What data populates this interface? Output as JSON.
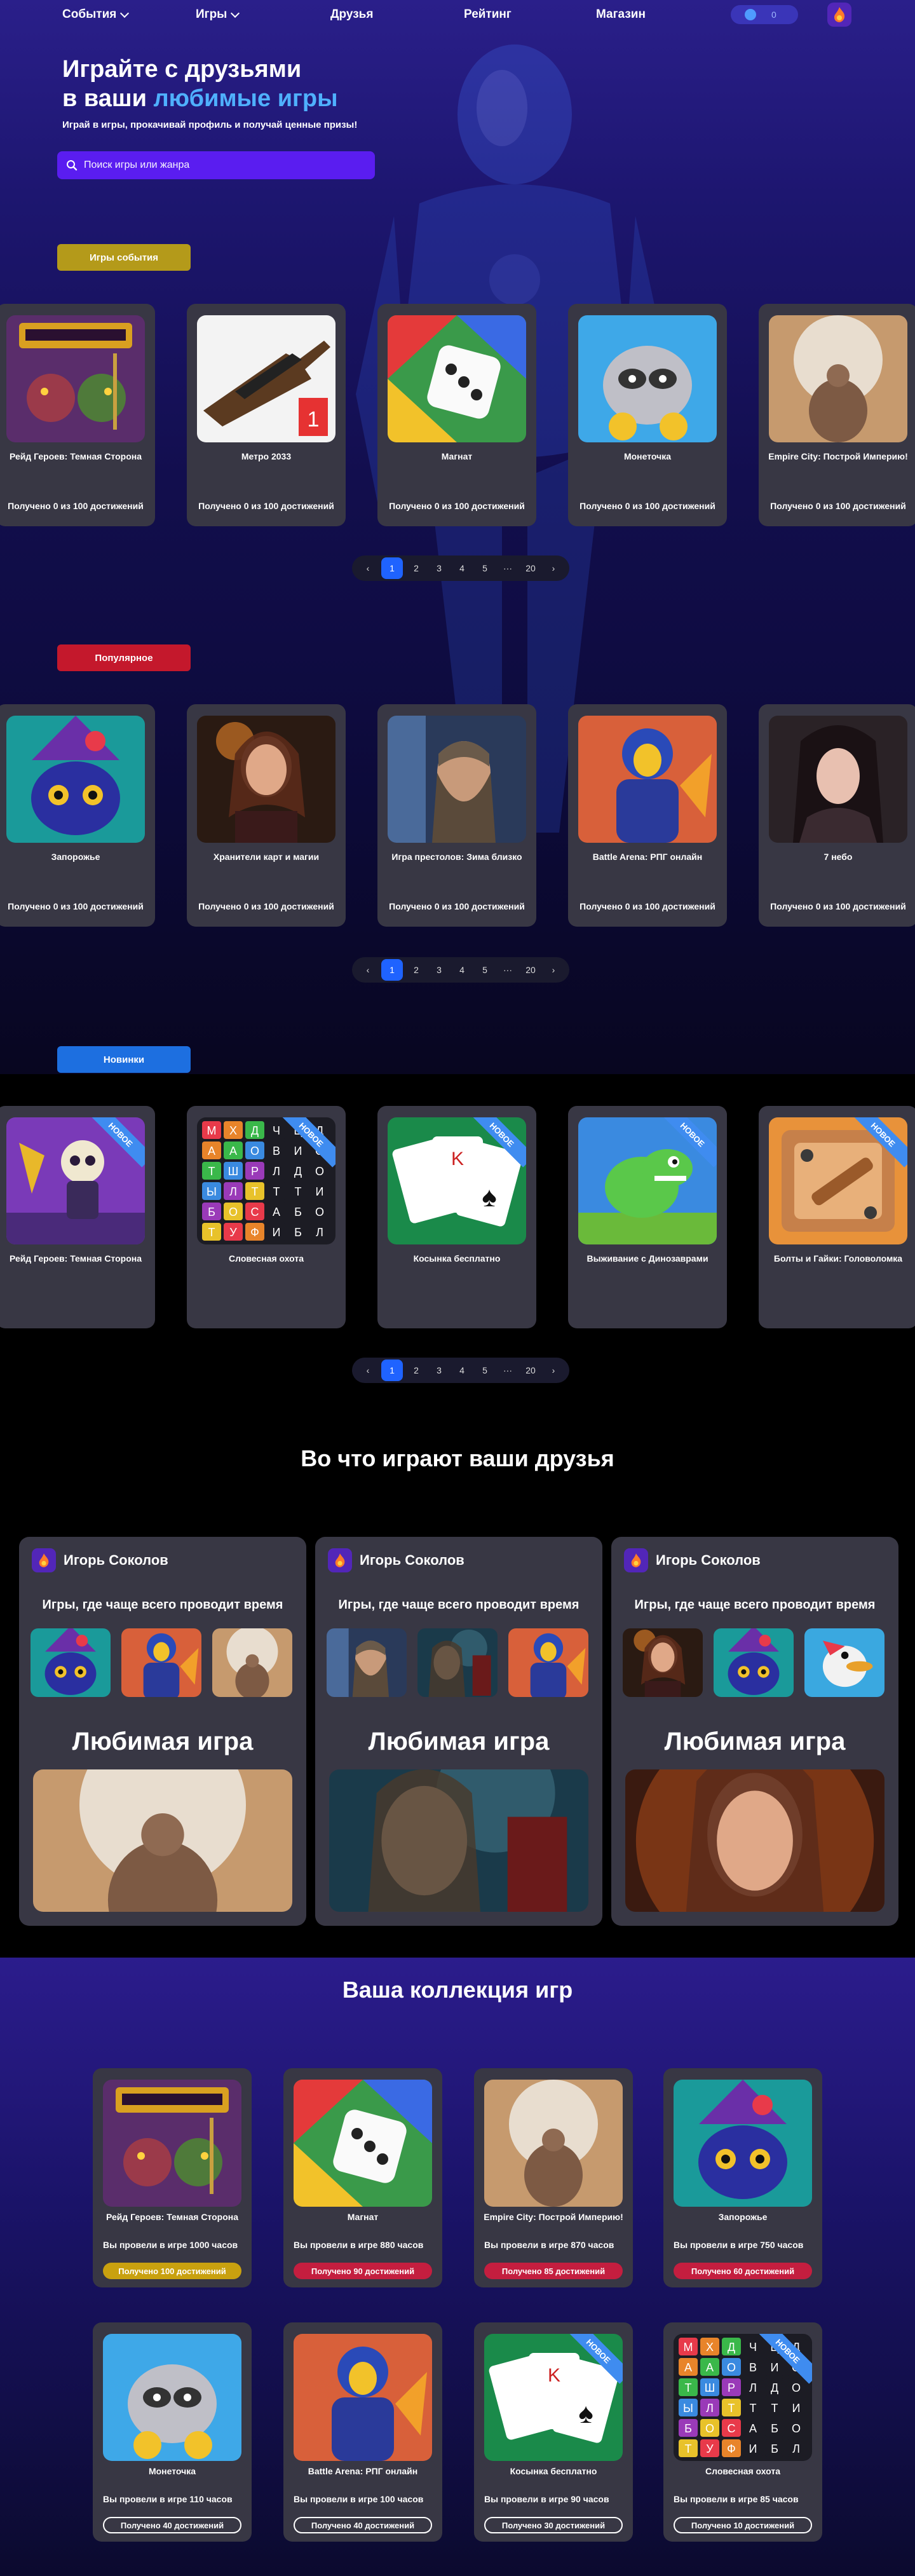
{
  "nav": {
    "events": "События",
    "games": "Игры",
    "friends": "Друзья",
    "rating": "Рейтинг",
    "shop": "Магазин",
    "toggle_value": "0"
  },
  "hero": {
    "title_line1": "Играйте с друзьями",
    "title_line2_prefix": "в ваши ",
    "title_line2_highlight": "любимые игры",
    "subtitle": "Играй в игры, прокачивай профиль и получай ценные призы!",
    "search_placeholder": "Поиск игры или жанра"
  },
  "sections": {
    "events": {
      "label": "Игры события",
      "color": "#b49a1a",
      "cards": [
        {
          "title": "Рейд Героев: Темная Сторона",
          "ach": "Получено 0 из 100 достижений",
          "icon": "knight-icon"
        },
        {
          "title": "Метро 2033",
          "ach": "Получено 0 из 100 достижений",
          "icon": "rifle-icon"
        },
        {
          "title": "Магнат",
          "ach": "Получено 0 из 100 достижений",
          "icon": "dice-icon"
        },
        {
          "title": "Монеточка",
          "ach": "Получено 0 из 100 достижений",
          "icon": "raccoon-icon"
        },
        {
          "title": "Empire City: Построй Империю!",
          "ach": "Получено 0 из 100 достижений",
          "icon": "atlas-icon"
        }
      ]
    },
    "popular": {
      "label": "Популярное",
      "color": "#c4182c",
      "cards": [
        {
          "title": "Запорожье",
          "ach": "Получено 0 из 100 достижений",
          "icon": "cat-wizard-icon"
        },
        {
          "title": "Хранители карт и магии",
          "ach": "Получено 0 из 100 достижений",
          "icon": "sorceress-icon"
        },
        {
          "title": "Игра престолов: Зима близко",
          "ach": "Получено 0 из 100 достижений",
          "icon": "king-icon"
        },
        {
          "title": "Battle Arena: РПГ онлайн",
          "ach": "Получено 0 из 100 достижений",
          "icon": "warrior-icon"
        },
        {
          "title": "7 небо",
          "ach": "Получено 0 из 100 достижений",
          "icon": "woman-icon"
        }
      ]
    },
    "new": {
      "label": "Новинки",
      "color": "#1d6fe0",
      "badge": "НОВОЕ",
      "cards": [
        {
          "title": "Рейд Героев: Темная Сторона",
          "icon": "skeleton-icon"
        },
        {
          "title": "Словесная охота",
          "icon": "letters-icon"
        },
        {
          "title": "Косынка бесплатно",
          "icon": "cards-icon"
        },
        {
          "title": "Выживание с Динозаврами",
          "icon": "dino-icon"
        },
        {
          "title": "Болты и Гайки: Головоломка",
          "icon": "bolts-icon"
        }
      ]
    }
  },
  "pager": [
    "1",
    "2",
    "3",
    "4",
    "5",
    "···",
    "20"
  ],
  "friends": {
    "heading": "Во что играют ваши друзья",
    "subtitle": "Игры, где чаще всего проводит время",
    "fav_label": "Любимая игра",
    "cards": [
      {
        "name": "Игорь Соколов"
      },
      {
        "name": "Игорь Соколов"
      },
      {
        "name": "Игорь Соколов"
      }
    ]
  },
  "collection": {
    "heading": "Ваша коллекция игр",
    "cards": [
      {
        "title": "Рейд Героев: Темная Сторона",
        "hours": "Вы провели в игре 1000 часов",
        "ach": "Получено 100 достижений",
        "style": "gold"
      },
      {
        "title": "Магнат",
        "hours": "Вы провели в игре 880 часов",
        "ach": "Получено 90 достижений",
        "style": "red"
      },
      {
        "title": "Empire City: Построй Империю!",
        "hours": "Вы провели в игре 870 часов",
        "ach": "Получено 85 достижений",
        "style": "red"
      },
      {
        "title": "Запорожье",
        "hours": "Вы провели в игре 750 часов",
        "ach": "Получено 60 достижений",
        "style": "red"
      },
      {
        "title": "Монеточка",
        "hours": "Вы провели в игре 110 часов",
        "ach": "Получено 40 достижений",
        "style": "outline"
      },
      {
        "title": "Battle Arena: РПГ онлайн",
        "hours": "Вы провели в игре 100 часов",
        "ach": "Получено 40 достижений",
        "style": "outline"
      },
      {
        "title": "Косынка бесплатно",
        "hours": "Вы провели в игре 90 часов",
        "ach": "Получено 30 достижений",
        "style": "outline"
      },
      {
        "title": "Словесная охота",
        "hours": "Вы провели в игре 85 часов",
        "ach": "Получено 10 достижений",
        "style": "outline"
      }
    ]
  }
}
